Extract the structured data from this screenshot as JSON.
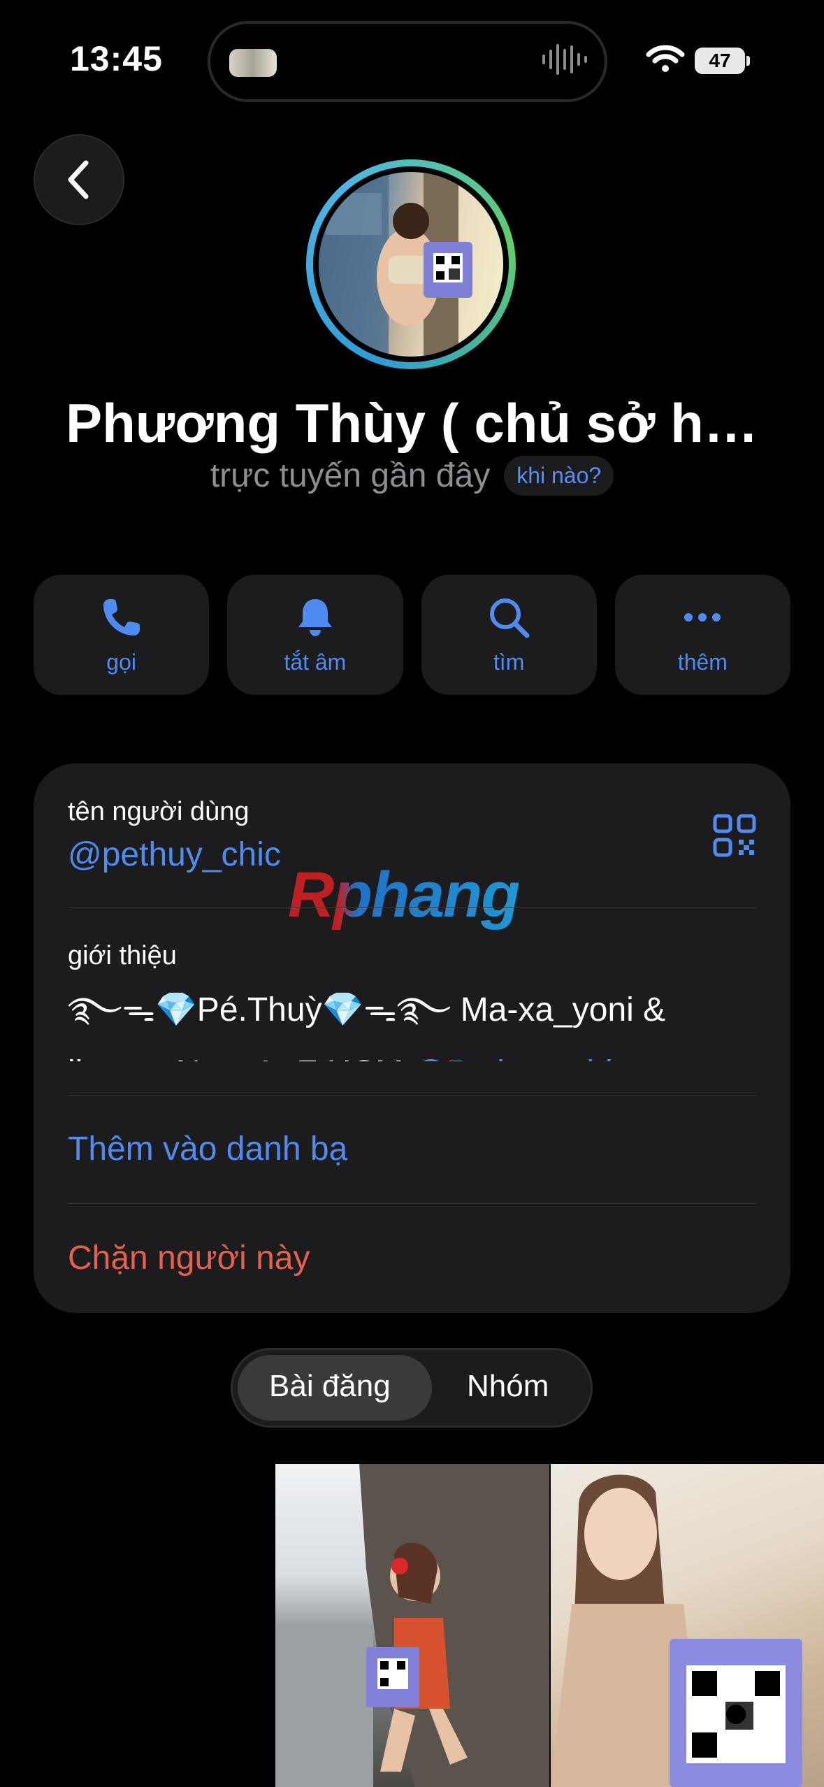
{
  "status_bar": {
    "time": "13:45",
    "battery": "47"
  },
  "profile": {
    "name": "Phương Thùy ( chủ sở h…",
    "status": "trực tuyến gần đây",
    "when_label": "khi nào?"
  },
  "actions": [
    {
      "label": "gọi",
      "icon": "phone-icon"
    },
    {
      "label": "tắt âm",
      "icon": "bell-icon"
    },
    {
      "label": "tìm",
      "icon": "search-icon"
    },
    {
      "label": "thêm",
      "icon": "more-icon"
    }
  ],
  "info": {
    "username_label": "tên người dùng",
    "username": "@pethuy_chic",
    "bio_label": "giới thiệu",
    "bio_line1": "࿐ᯓ💎Pé.Thuỳ💎ᯓ࿐ Ma-xa_yoni &",
    "bio_line2_text": "lingam Nam A- Z HCM ",
    "bio_line2_link": "@Pethuy_chic",
    "add_contact": "Thêm vào danh bạ",
    "block": "Chặn người này"
  },
  "watermark": "Rphang",
  "tabs": [
    {
      "label": "Bài đăng",
      "active": true
    },
    {
      "label": "Nhóm",
      "active": false
    }
  ],
  "colors": {
    "accent": "#4f8bf0",
    "danger": "#e5604d",
    "card": "#1c1c1e"
  }
}
